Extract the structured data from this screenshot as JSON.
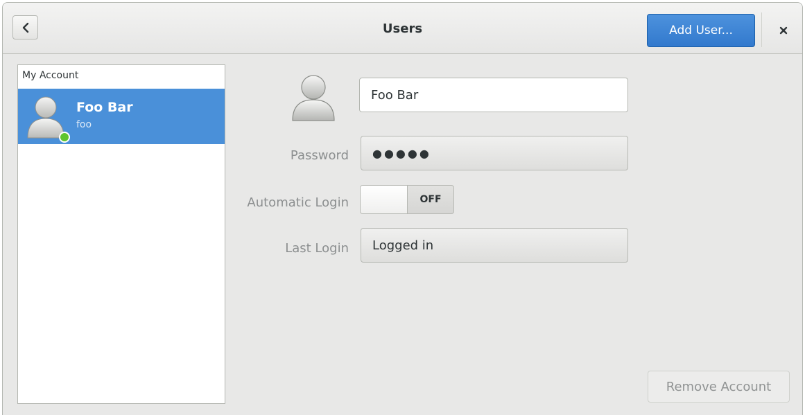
{
  "header": {
    "title": "Users",
    "add_user_label": "Add User...",
    "back_icon": "chevron-left-icon",
    "close_icon": "close-icon"
  },
  "sidebar": {
    "section_label": "My Account",
    "accounts": [
      {
        "name": "Foo Bar",
        "username": "foo",
        "online": true,
        "selected": true
      }
    ]
  },
  "details": {
    "full_name_value": "Foo Bar",
    "password_label": "Password",
    "password_value": "●●●●●",
    "auto_login_label": "Automatic Login",
    "auto_login_state": "OFF",
    "last_login_label": "Last Login",
    "last_login_value": "Logged in",
    "remove_account_label": "Remove Account"
  },
  "colors": {
    "accent": "#4a90d9",
    "online": "#5fc52f"
  }
}
